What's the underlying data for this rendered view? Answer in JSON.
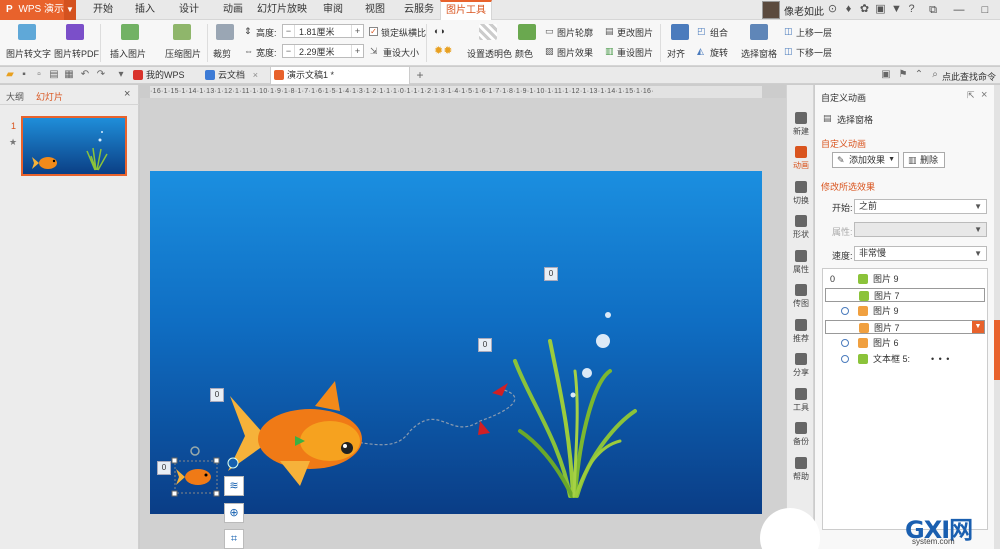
{
  "title_bar": {
    "app_name": "WPS 演示",
    "app_logo": "P",
    "menu_tabs": [
      "开始",
      "插入",
      "设计",
      "动画",
      "幻灯片放映",
      "审阅",
      "视图",
      "云服务",
      "图片工具"
    ],
    "active_tab": "图片工具",
    "user_name": "像老如此"
  },
  "ribbon": {
    "pic_to_text": "图片转文字",
    "pic_to_pdf": "图片转PDF",
    "insert_picture": "插入图片",
    "compress": "压缩图片",
    "crop": "裁剪",
    "height_label": "高度:",
    "height_value": "1.81厘米",
    "width_label": "宽度:",
    "width_value": "2.29厘米",
    "lock_ratio": "锁定纵横比",
    "reset_size": "重设大小",
    "set_transparent": "设置透明色",
    "color": "颜色",
    "pic_outline": "图片轮廓",
    "pic_effect": "图片效果",
    "change_pic": "更改图片",
    "reset_pic": "重设图片",
    "align": "对齐",
    "group": "组合",
    "rotate": "旋转",
    "selection_pane": "选择窗格",
    "bring_forward": "上移一层",
    "send_backward": "下移一层"
  },
  "tab_bar": {
    "tabs": [
      "我的WPS",
      "云文档",
      "演示文稿1 *"
    ],
    "active_tab": "演示文稿1 *",
    "search_label": "点此查找命令"
  },
  "left_panel": {
    "tabs": [
      "大纲",
      "幻灯片"
    ],
    "active_tab": "幻灯片",
    "slide_number": "1"
  },
  "ruler_text": "·16·1·15·1·14·1·13·1·12·1·11·1·10·1·9·1·8·1·7·1·6·1·5·1·4·1·3·1·2·1·1·1·0·1·1·1·2·1·3·1·4·1·5·1·6·1·7·1·8·1·9·1·10·1·11·1·12·1·13·1·14·1·15·1·16·",
  "slide": {
    "badges": [
      "0",
      "0",
      "0",
      "0"
    ]
  },
  "sidebar": {
    "items": [
      "新建",
      "动画",
      "切换",
      "形状",
      "属性",
      "传图",
      "推荐",
      "分享",
      "工具",
      "备份",
      "帮助"
    ],
    "active": "动画"
  },
  "pane": {
    "title": "自定义动画",
    "selection_pane": "选择窗格",
    "section_title": "自定义动画",
    "add_effect": "添加效果",
    "delete": "删除",
    "modify_title": "修改所选效果",
    "start_label": "开始:",
    "start_value": "之前",
    "property_label": "属性:",
    "property_value": "",
    "speed_label": "速度:",
    "speed_value": "非常慢",
    "anim_items": [
      {
        "num": "0",
        "name": "图片 9"
      },
      {
        "num": "",
        "name": "图片 7"
      },
      {
        "num": "",
        "name": "图片 9"
      },
      {
        "num": "",
        "name": "图片 7"
      },
      {
        "num": "",
        "name": "图片 6"
      },
      {
        "num": "",
        "name": "文本框 5:"
      }
    ],
    "ellipsis": "• • •"
  },
  "watermark": {
    "brand": "GXI网",
    "sub": "system.com"
  },
  "colors": {
    "accent": "#e8622c",
    "slide_top": "#1b8fe0",
    "slide_bottom": "#0a3d86"
  }
}
